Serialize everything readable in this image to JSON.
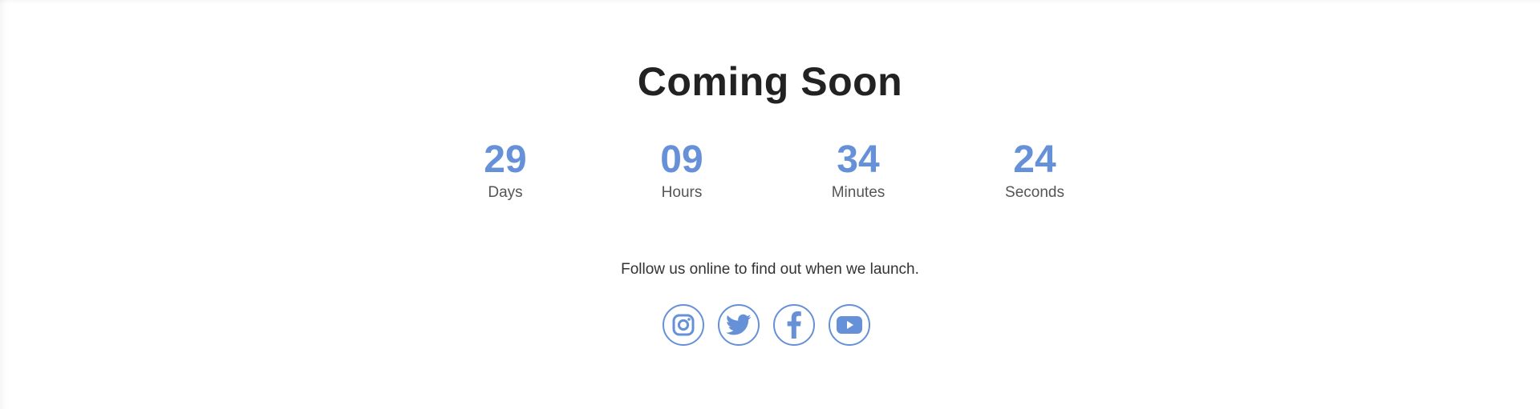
{
  "page": {
    "title": "Coming Soon",
    "tagline": "Follow us online to find out when we launch."
  },
  "countdown": [
    {
      "value": "29",
      "label": "Days"
    },
    {
      "value": "09",
      "label": "Hours"
    },
    {
      "value": "34",
      "label": "Minutes"
    },
    {
      "value": "24",
      "label": "Seconds"
    }
  ],
  "social": [
    {
      "name": "instagram",
      "icon": "instagram-icon"
    },
    {
      "name": "twitter",
      "icon": "twitter-icon"
    },
    {
      "name": "facebook",
      "icon": "facebook-icon"
    },
    {
      "name": "youtube",
      "icon": "youtube-icon"
    }
  ],
  "colors": {
    "accent": "#6690d8",
    "title": "#222222",
    "label": "#555555",
    "text": "#333333",
    "background": "#ffffff"
  }
}
